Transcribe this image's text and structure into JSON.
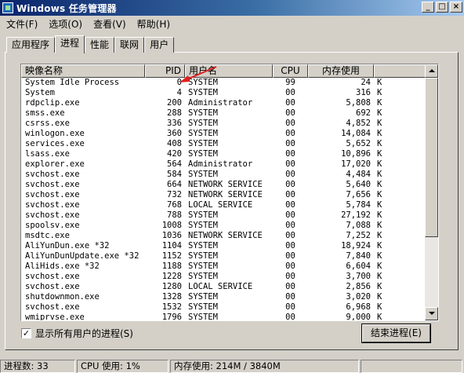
{
  "window": {
    "title": "Windows 任务管理器"
  },
  "title_buttons": {
    "minimize": "_",
    "maximize": "□",
    "close": "×"
  },
  "menu": [
    "文件(F)",
    "选项(O)",
    "查看(V)",
    "帮助(H)"
  ],
  "tabs": [
    "应用程序",
    "进程",
    "性能",
    "联网",
    "用户"
  ],
  "columns": {
    "name": "映像名称",
    "pid": "PID",
    "user": "用户名",
    "cpu": "CPU",
    "mem": "内存使用"
  },
  "processes": [
    {
      "name": "System Idle Process",
      "pid": "0",
      "user": "SYSTEM",
      "cpu": "99",
      "mem": "24",
      "unit": "K"
    },
    {
      "name": "System",
      "pid": "4",
      "user": "SYSTEM",
      "cpu": "00",
      "mem": "316",
      "unit": "K"
    },
    {
      "name": "rdpclip.exe",
      "pid": "200",
      "user": "Administrator",
      "cpu": "00",
      "mem": "5,808",
      "unit": "K"
    },
    {
      "name": "smss.exe",
      "pid": "288",
      "user": "SYSTEM",
      "cpu": "00",
      "mem": "692",
      "unit": "K"
    },
    {
      "name": "csrss.exe",
      "pid": "336",
      "user": "SYSTEM",
      "cpu": "00",
      "mem": "4,852",
      "unit": "K"
    },
    {
      "name": "winlogon.exe",
      "pid": "360",
      "user": "SYSTEM",
      "cpu": "00",
      "mem": "14,084",
      "unit": "K"
    },
    {
      "name": "services.exe",
      "pid": "408",
      "user": "SYSTEM",
      "cpu": "00",
      "mem": "5,652",
      "unit": "K"
    },
    {
      "name": "lsass.exe",
      "pid": "420",
      "user": "SYSTEM",
      "cpu": "00",
      "mem": "10,896",
      "unit": "K"
    },
    {
      "name": "explorer.exe",
      "pid": "564",
      "user": "Administrator",
      "cpu": "00",
      "mem": "17,020",
      "unit": "K"
    },
    {
      "name": "svchost.exe",
      "pid": "584",
      "user": "SYSTEM",
      "cpu": "00",
      "mem": "4,484",
      "unit": "K"
    },
    {
      "name": "svchost.exe",
      "pid": "664",
      "user": "NETWORK SERVICE",
      "cpu": "00",
      "mem": "5,640",
      "unit": "K"
    },
    {
      "name": "svchost.exe",
      "pid": "732",
      "user": "NETWORK SERVICE",
      "cpu": "00",
      "mem": "7,656",
      "unit": "K"
    },
    {
      "name": "svchost.exe",
      "pid": "768",
      "user": "LOCAL SERVICE",
      "cpu": "00",
      "mem": "5,784",
      "unit": "K"
    },
    {
      "name": "svchost.exe",
      "pid": "788",
      "user": "SYSTEM",
      "cpu": "00",
      "mem": "27,192",
      "unit": "K"
    },
    {
      "name": "spoolsv.exe",
      "pid": "1008",
      "user": "SYSTEM",
      "cpu": "00",
      "mem": "7,088",
      "unit": "K"
    },
    {
      "name": "msdtc.exe",
      "pid": "1036",
      "user": "NETWORK SERVICE",
      "cpu": "00",
      "mem": "7,252",
      "unit": "K"
    },
    {
      "name": "AliYunDun.exe *32",
      "pid": "1104",
      "user": "SYSTEM",
      "cpu": "00",
      "mem": "18,924",
      "unit": "K"
    },
    {
      "name": "AliYunDunUpdate.exe *32",
      "pid": "1152",
      "user": "SYSTEM",
      "cpu": "00",
      "mem": "7,840",
      "unit": "K"
    },
    {
      "name": "AliHids.exe *32",
      "pid": "1188",
      "user": "SYSTEM",
      "cpu": "00",
      "mem": "6,604",
      "unit": "K"
    },
    {
      "name": "svchost.exe",
      "pid": "1228",
      "user": "SYSTEM",
      "cpu": "00",
      "mem": "3,700",
      "unit": "K"
    },
    {
      "name": "svchost.exe",
      "pid": "1280",
      "user": "LOCAL SERVICE",
      "cpu": "00",
      "mem": "2,856",
      "unit": "K"
    },
    {
      "name": "shutdownmon.exe",
      "pid": "1328",
      "user": "SYSTEM",
      "cpu": "00",
      "mem": "3,020",
      "unit": "K"
    },
    {
      "name": "svchost.exe",
      "pid": "1532",
      "user": "SYSTEM",
      "cpu": "00",
      "mem": "6,968",
      "unit": "K"
    },
    {
      "name": "wmiprvse.exe",
      "pid": "1796",
      "user": "SYSTEM",
      "cpu": "00",
      "mem": "9,000",
      "unit": "K"
    }
  ],
  "show_all_users": {
    "label": "显示所有用户的进程(S)",
    "checked": true,
    "check_glyph": "✓"
  },
  "end_process_button": "结束进程(E)",
  "status": {
    "processes": "进程数: 33",
    "cpu": "CPU 使用: 1%",
    "memory": "内存使用: 214M / 3840M"
  },
  "colors": {
    "title_start": "#0a246a",
    "title_end": "#a6caf0",
    "annotation_arrow": "#e02020"
  },
  "icons": {
    "app": "task-manager-icon",
    "annotation": "red-arrow-icon"
  }
}
